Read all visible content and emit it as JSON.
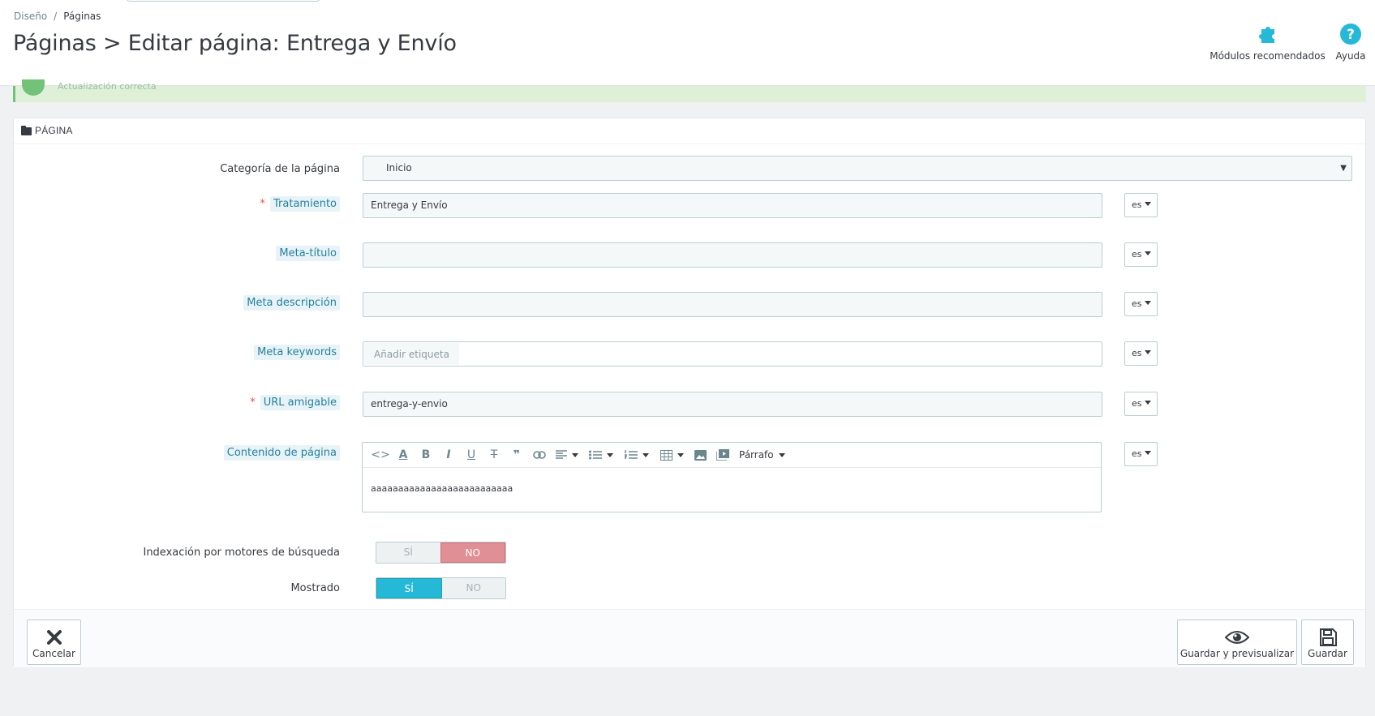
{
  "breadcrumb": {
    "parent": "Diseño",
    "separator": "/",
    "current": "Páginas"
  },
  "page_title": "Páginas > Editar página: Entrega y Envío",
  "toolbar": {
    "modules_label": "Módulos recomendados",
    "help_label": "Ayuda"
  },
  "alert": {
    "text": "Actualización correcta"
  },
  "panel": {
    "title": "PÁGINA"
  },
  "form": {
    "category": {
      "label": "Categoría de la página",
      "value": "Inicio"
    },
    "title": {
      "label": "Tratamiento",
      "required": "*",
      "value": "Entrega y Envío",
      "lang": "es"
    },
    "meta_title": {
      "label": "Meta-título",
      "value": "",
      "lang": "es"
    },
    "meta_description": {
      "label": "Meta descripción",
      "value": "",
      "lang": "es"
    },
    "meta_keywords": {
      "label": "Meta keywords",
      "placeholder": "Añadir etiqueta",
      "lang": "es"
    },
    "friendly_url": {
      "label": "URL amigable",
      "required": "*",
      "value": "entrega-y-envio",
      "lang": "es"
    },
    "content": {
      "label": "Contenido de página",
      "value": "aaaaaaaaaaaaaaaaaaaaaaaaaa",
      "lang": "es",
      "format_label": "Párrafo"
    },
    "indexation": {
      "label": "Indexación por motores de búsqueda",
      "yes": "SÍ",
      "no": "NO",
      "selected": "NO"
    },
    "displayed": {
      "label": "Mostrado",
      "yes": "SÍ",
      "no": "NO",
      "selected": "SÍ"
    }
  },
  "footer": {
    "cancel_label": "Cancelar",
    "preview_label": "Guardar y previsualizar",
    "save_label": "Guardar"
  },
  "colors": {
    "accent": "#25b9d7",
    "no_active": "#e08f95",
    "success": "#72c279",
    "label_hint": "#25809b"
  }
}
